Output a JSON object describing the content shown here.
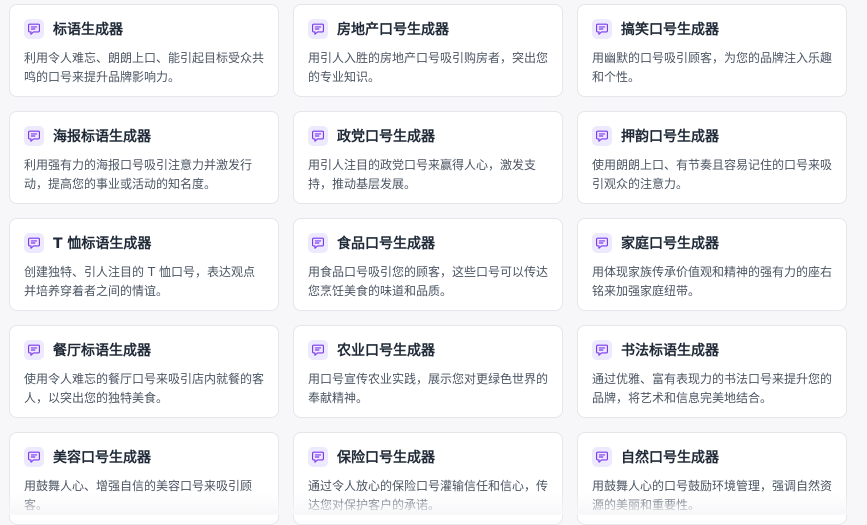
{
  "accent_color": "#7c3aed",
  "icon_bg_color": "#ede9fe",
  "cards": [
    {
      "title": "标语生成器",
      "desc": "利用令人难忘、朗朗上口、能引起目标受众共鸣的口号来提升品牌影响力。",
      "icon": "message-icon"
    },
    {
      "title": "房地产口号生成器",
      "desc": "用引人入胜的房地产口号吸引购房者，突出您的专业知识。",
      "icon": "message-icon"
    },
    {
      "title": "搞笑口号生成器",
      "desc": "用幽默的口号吸引顾客，为您的品牌注入乐趣和个性。",
      "icon": "message-icon"
    },
    {
      "title": "海报标语生成器",
      "desc": "利用强有力的海报口号吸引注意力并激发行动，提高您的事业或活动的知名度。",
      "icon": "message-icon"
    },
    {
      "title": "政党口号生成器",
      "desc": "用引人注目的政党口号来赢得人心，激发支持，推动基层发展。",
      "icon": "message-icon"
    },
    {
      "title": "押韵口号生成器",
      "desc": "使用朗朗上口、有节奏且容易记住的口号来吸引观众的注意力。",
      "icon": "message-icon"
    },
    {
      "title": "T 恤标语生成器",
      "desc": "创建独特、引人注目的 T 恤口号，表达观点并培养穿着者之间的情谊。",
      "icon": "message-icon"
    },
    {
      "title": "食品口号生成器",
      "desc": "用食品口号吸引您的顾客，这些口号可以传达您烹饪美食的味道和品质。",
      "icon": "message-icon"
    },
    {
      "title": "家庭口号生成器",
      "desc": "用体现家族传承价值观和精神的强有力的座右铭来加强家庭纽带。",
      "icon": "message-icon"
    },
    {
      "title": "餐厅标语生成器",
      "desc": "使用令人难忘的餐厅口号来吸引店内就餐的客人，以突出您的独特美食。",
      "icon": "message-icon"
    },
    {
      "title": "农业口号生成器",
      "desc": "用口号宣传农业实践，展示您对更绿色世界的奉献精神。",
      "icon": "message-icon"
    },
    {
      "title": "书法标语生成器",
      "desc": "通过优雅、富有表现力的书法口号来提升您的品牌，将艺术和信息完美地结合。",
      "icon": "message-icon"
    },
    {
      "title": "美容口号生成器",
      "desc": "用鼓舞人心、增强自信的美容口号来吸引顾客。",
      "icon": "message-icon"
    },
    {
      "title": "保险口号生成器",
      "desc": "通过令人放心的保险口号灌输信任和信心，传达您对保护客户的承诺。",
      "icon": "message-icon"
    },
    {
      "title": "自然口号生成器",
      "desc": "用鼓舞人心的口号鼓励环境管理，强调自然资源的美丽和重要性。",
      "icon": "message-icon"
    }
  ]
}
